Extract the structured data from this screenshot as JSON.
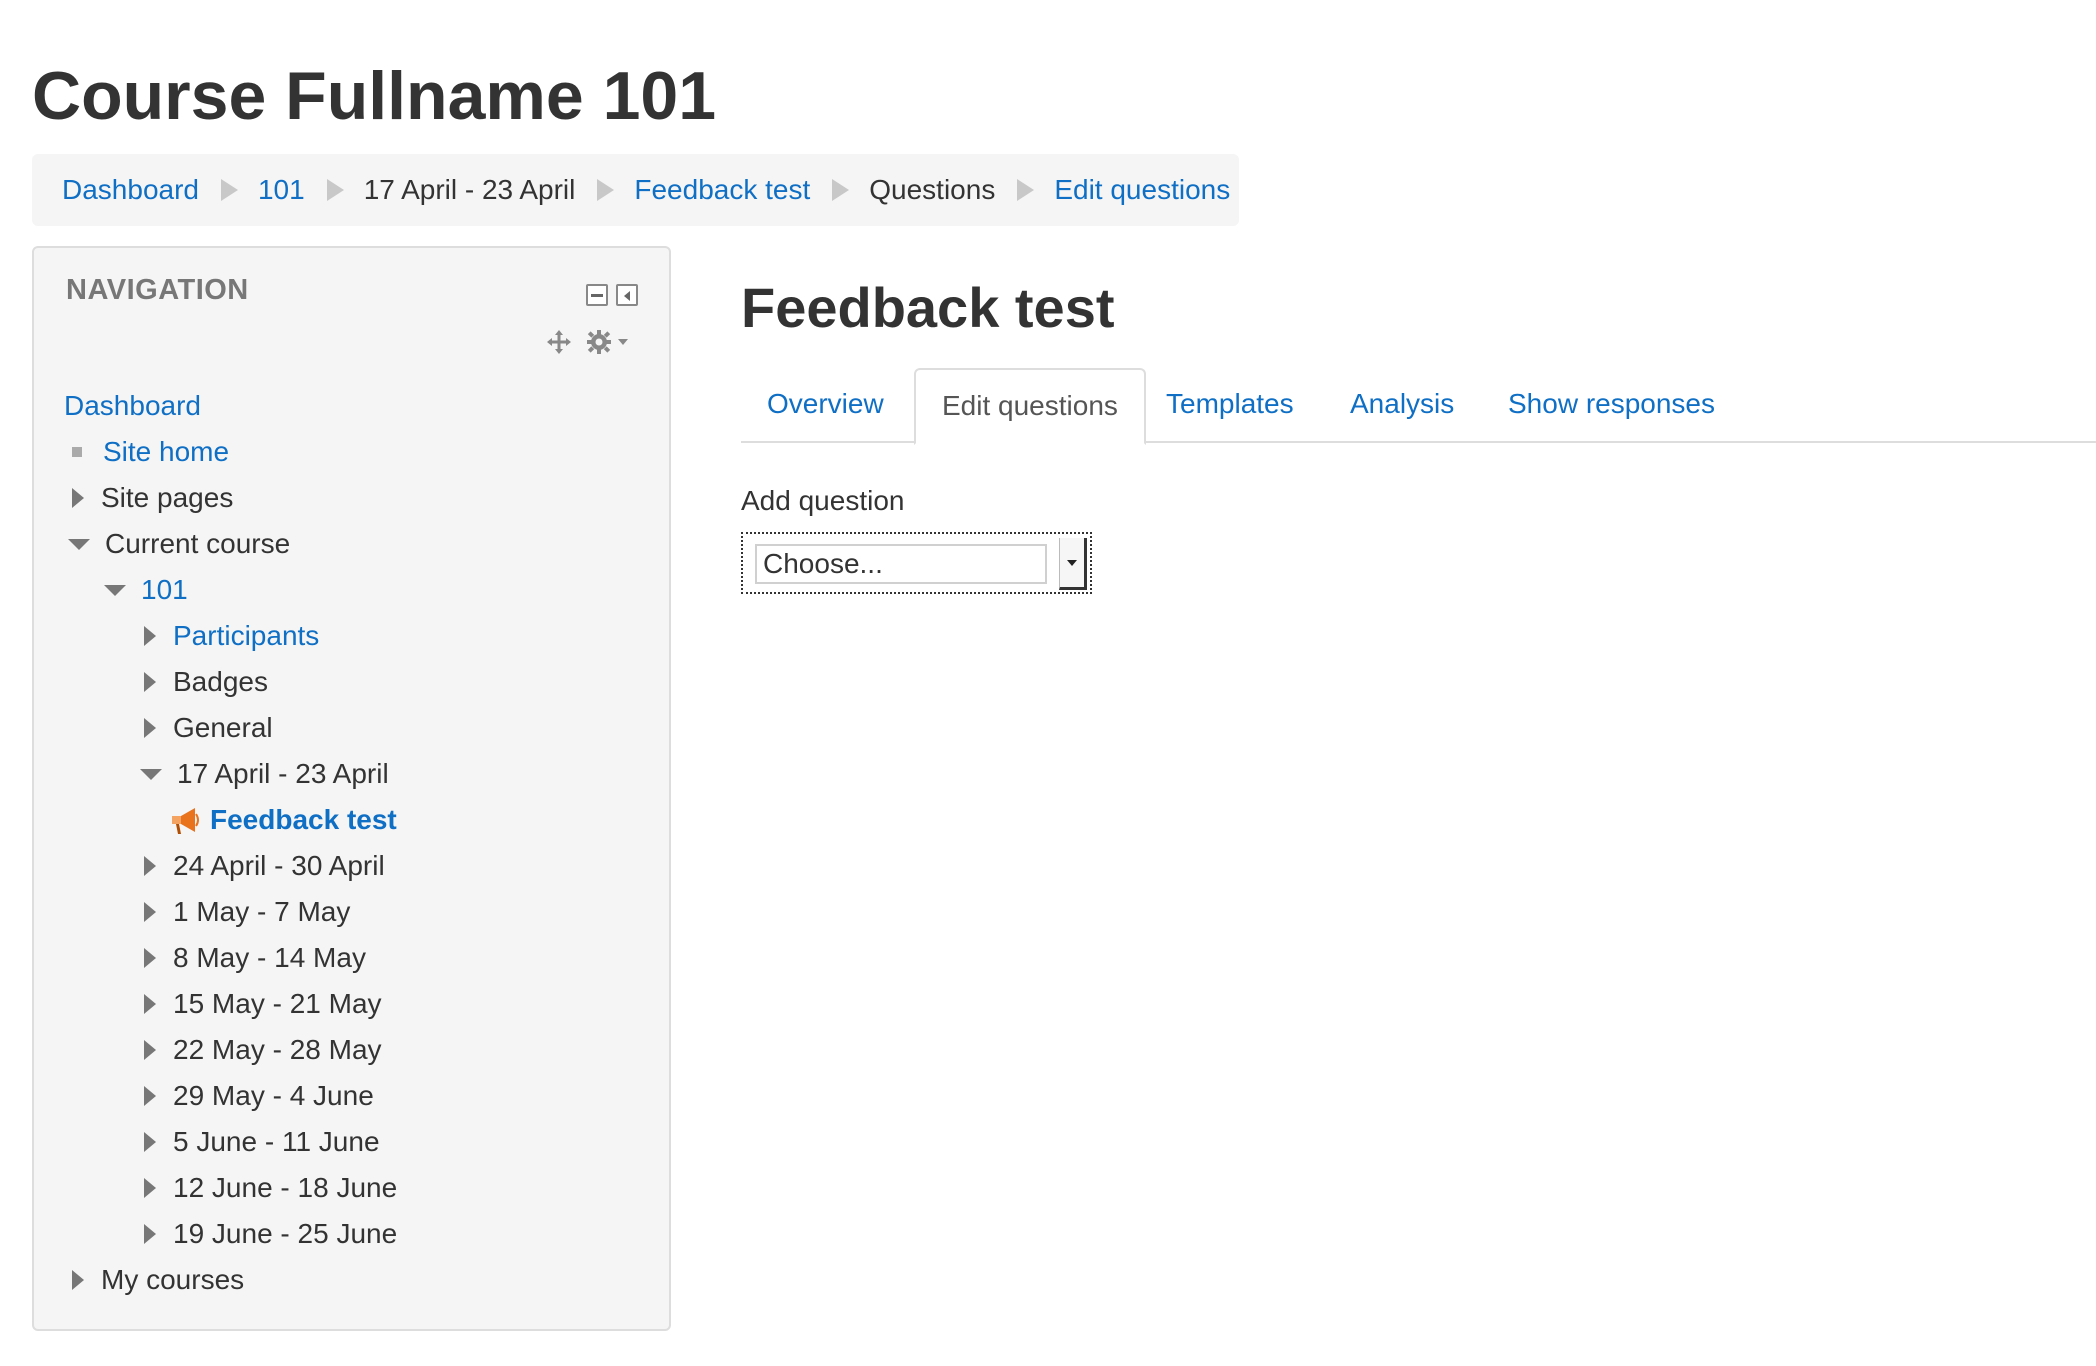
{
  "page": {
    "course_title": "Course Fullname 101"
  },
  "breadcrumb": [
    {
      "label": "Dashboard"
    },
    {
      "label": "101"
    },
    {
      "label": "17 April - 23 April"
    },
    {
      "label": "Feedback test"
    },
    {
      "label": "Questions"
    },
    {
      "label": "Edit questions"
    }
  ],
  "navigation": {
    "header": "NAVIGATION",
    "items": [
      {
        "label": "Dashboard"
      },
      {
        "label": "Site home"
      },
      {
        "label": "Site pages"
      },
      {
        "label": "Current course"
      },
      {
        "label": "101"
      },
      {
        "label": "Participants"
      },
      {
        "label": "Badges"
      },
      {
        "label": "General"
      },
      {
        "label": "17 April - 23 April"
      },
      {
        "label": "Feedback test"
      },
      {
        "label": "24 April - 30 April"
      },
      {
        "label": "1 May - 7 May"
      },
      {
        "label": "8 May - 14 May"
      },
      {
        "label": "15 May - 21 May"
      },
      {
        "label": "22 May - 28 May"
      },
      {
        "label": "29 May - 4 June"
      },
      {
        "label": "5 June - 11 June"
      },
      {
        "label": "12 June - 18 June"
      },
      {
        "label": "19 June - 25 June"
      },
      {
        "label": "My courses"
      }
    ]
  },
  "main": {
    "activity_title": "Feedback test",
    "tabs": [
      {
        "label": "Overview"
      },
      {
        "label": "Edit questions"
      },
      {
        "label": "Templates"
      },
      {
        "label": "Analysis"
      },
      {
        "label": "Show responses"
      }
    ],
    "active_tab": "Edit questions",
    "add_question_label": "Add question",
    "add_question_value": "Choose..."
  },
  "colors": {
    "link": "#0f6fc5",
    "text": "#333333",
    "block_bg": "#f5f5f5",
    "icon_orange": "#e8731c"
  }
}
